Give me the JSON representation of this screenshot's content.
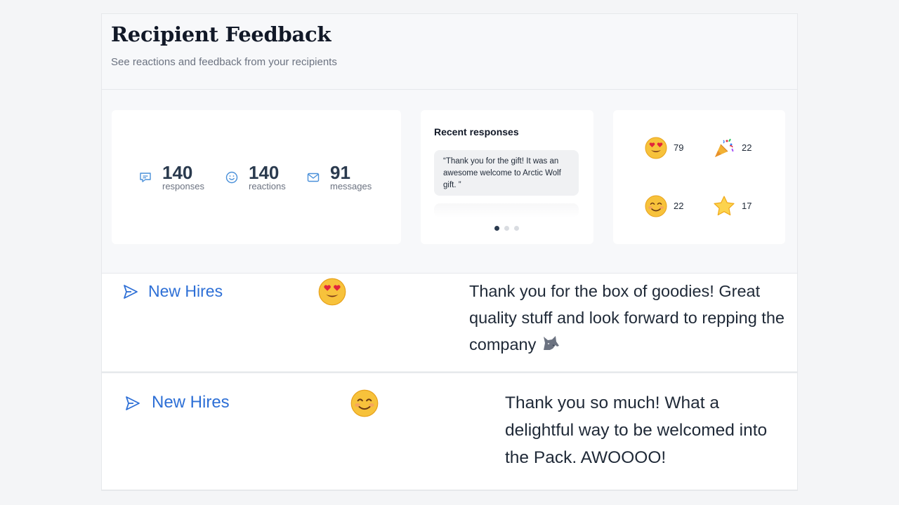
{
  "header": {
    "title": "Recipient Feedback",
    "subtitle": "See reactions and feedback from your recipients"
  },
  "stats": [
    {
      "icon": "chat-bubble-icon",
      "value": "140",
      "label": "responses"
    },
    {
      "icon": "smiley-face-icon",
      "value": "140",
      "label": "reactions"
    },
    {
      "icon": "envelope-icon",
      "value": "91",
      "label": "messages"
    }
  ],
  "recent": {
    "title": "Recent responses",
    "quote": "“Thank you for the gift! It was an awesome welcome to Arctic Wolf gift. ”",
    "carousel_pages": 3,
    "active_page": 1
  },
  "reactions": [
    {
      "icon": "heart-eyes-emoji-icon",
      "count": "79"
    },
    {
      "icon": "party-popper-emoji-icon",
      "count": "22"
    },
    {
      "icon": "smiling-face-emoji-icon",
      "count": "22"
    },
    {
      "icon": "star-emoji-icon",
      "count": "17"
    }
  ],
  "feedback_rows": [
    {
      "group": "New Hires",
      "reaction_icon": "heart-eyes-emoji-icon",
      "message": "Thank you for the box of goodies! Great quality stuff and look forward to repping the company",
      "message_emoji": "wolf-emoji-icon"
    },
    {
      "group": "New Hires",
      "reaction_icon": "smiling-face-emoji-icon",
      "message": "Thank you so much! What a delightful way to be welcomed into the Pack. AWOOOO!"
    }
  ],
  "colors": {
    "accent_blue": "#2d6fd6",
    "icon_blue": "#4a90d9",
    "stat_number": "#2a3a4e",
    "emoji_yellow": "#f7c23b"
  }
}
